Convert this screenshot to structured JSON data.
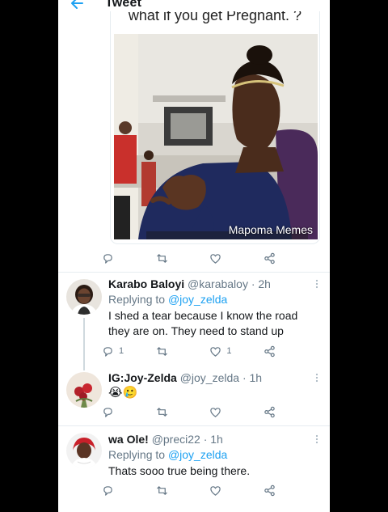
{
  "header": {
    "title": "Tweet"
  },
  "media": {
    "caption": "what if you get Pregnant. ?",
    "watermark": "Mapoma Memes"
  },
  "colors": {
    "accent": "#1da1f2",
    "muted": "#657786",
    "text": "#14171a",
    "divider": "#e6ecf0"
  },
  "tweet_actions": {
    "reply_count": "",
    "retweet_count": "",
    "like_count": ""
  },
  "replies": [
    {
      "name": "Karabo Baloyi",
      "handle": "@karabaloy",
      "time": "· 2h",
      "replying_prefix": "Replying to",
      "replying_to": "@joy_zelda",
      "text": "I shed a tear because I know the road they are on. They need to stand up",
      "reply_count": "1",
      "retweet_count": "",
      "like_count": "1"
    },
    {
      "name": "IG:Joy-Zelda",
      "handle": "@joy_zelda",
      "time": "· 1h",
      "emoji": "😭🥲",
      "reply_count": "",
      "retweet_count": "",
      "like_count": ""
    },
    {
      "name": "wa Ole!",
      "handle": "@preci22",
      "time": "· 1h",
      "replying_prefix": "Replying to",
      "replying_to": "@joy_zelda",
      "text": "Thats sooo true being there.",
      "reply_count": "",
      "retweet_count": "",
      "like_count": ""
    }
  ]
}
